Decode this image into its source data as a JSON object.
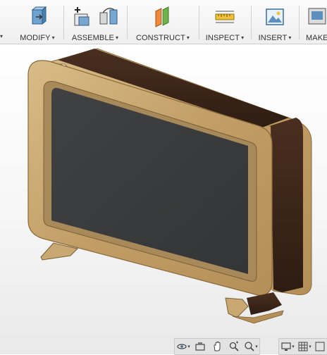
{
  "toolbar": {
    "groups": [
      {
        "label": "MODIFY"
      },
      {
        "label": "ASSEMBLE"
      },
      {
        "label": "CONSTRUCT"
      },
      {
        "label": "INSPECT"
      },
      {
        "label": "INSERT"
      },
      {
        "label": "MAKE"
      }
    ],
    "caret": "▾"
  },
  "icons": {
    "modify": "press-pull-icon",
    "assemble_new": "new-component-icon",
    "assemble_joint": "joint-icon",
    "construct": "offset-plane-icon",
    "inspect": "measure-icon",
    "insert": "insert-image-icon",
    "make": "3d-print-icon"
  },
  "navbar": {
    "items": [
      "orbit-icon",
      "look-at-icon",
      "pan-icon",
      "zoom-icon",
      "fit-icon",
      "display-settings-icon",
      "grid-icon",
      "viewports-icon"
    ],
    "caret": "▾"
  },
  "colors": {
    "wood_light": "#c9a872",
    "wood_dark": "#3d261a",
    "screen": "#3a3b3c"
  }
}
